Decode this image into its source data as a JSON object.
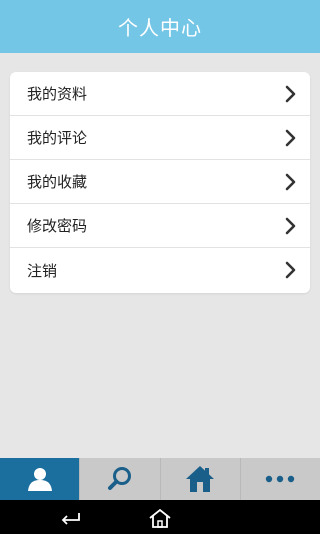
{
  "header": {
    "title": "个人中心"
  },
  "menu": {
    "items": [
      {
        "label": "我的资料"
      },
      {
        "label": "我的评论"
      },
      {
        "label": "我的收藏"
      },
      {
        "label": "修改密码"
      },
      {
        "label": "注销"
      }
    ]
  },
  "tabbar": {
    "tabs": [
      {
        "icon": "user-icon",
        "active": true
      },
      {
        "icon": "search-icon",
        "active": false
      },
      {
        "icon": "home-icon",
        "active": false
      },
      {
        "icon": "more-icon",
        "active": false
      }
    ]
  },
  "system_nav": {
    "buttons": [
      {
        "icon": "back-icon"
      },
      {
        "icon": "home-icon"
      }
    ]
  },
  "colors": {
    "header_bg": "#74c6e6",
    "tab_active": "#1b6f9f",
    "tab_bg": "#c9c9c9",
    "icon_blue": "#1a5f8a"
  }
}
